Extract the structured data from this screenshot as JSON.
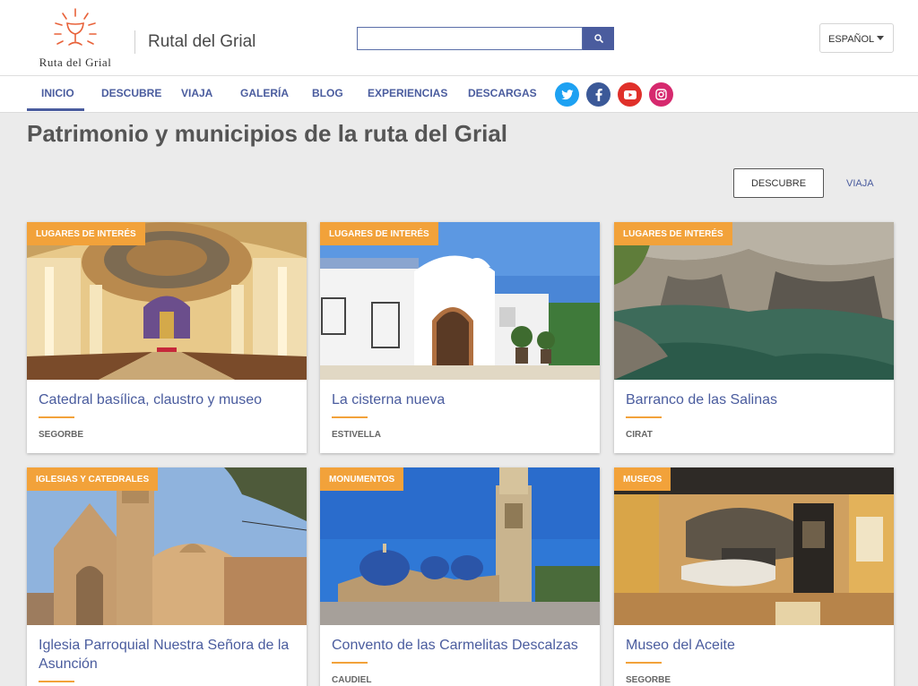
{
  "header": {
    "logo_text": "Ruta del Grial",
    "site_title": "Rutal del Grial",
    "search_placeholder": "",
    "language": "ESPAÑOL"
  },
  "nav": {
    "items": [
      "INICIO",
      "DESCUBRE",
      "VIAJA",
      "GALERÍA",
      "BLOG",
      "EXPERIENCIAS",
      "DESCARGAS"
    ],
    "active": "INICIO",
    "social": [
      "twitter-icon",
      "facebook-icon",
      "youtube-icon",
      "instagram-icon"
    ]
  },
  "main": {
    "title": "Patrimonio y municipios de la ruta del Grial",
    "filter_primary": "DESCUBRE",
    "filter_secondary": "VIAJA"
  },
  "cards": [
    {
      "badge": "LUGARES DE INTERÉS",
      "title": "Catedral basílica, claustro y museo",
      "town": "SEGORBE"
    },
    {
      "badge": "LUGARES DE INTERÉS",
      "title": "La cisterna nueva",
      "town": "ESTIVELLA"
    },
    {
      "badge": "LUGARES DE INTERÉS",
      "title": "Barranco de las Salinas",
      "town": "CIRAT"
    },
    {
      "badge": "IGLESIAS Y CATEDRALES",
      "title": "Iglesia Parroquial Nuestra Señora de la Asunción",
      "town": ""
    },
    {
      "badge": "MONUMENTOS",
      "title": "Convento de las Carmelitas Descalzas",
      "town": "CAUDIEL"
    },
    {
      "badge": "MUSEOS",
      "title": "Museo del Aceite",
      "town": "SEGORBE"
    }
  ],
  "colors": {
    "brand": "#4a5c9e",
    "accent": "#f2a23a",
    "twitter": "#1da1f2",
    "facebook": "#3b5998",
    "youtube": "#e0302a",
    "instagram": "#d6296e"
  }
}
